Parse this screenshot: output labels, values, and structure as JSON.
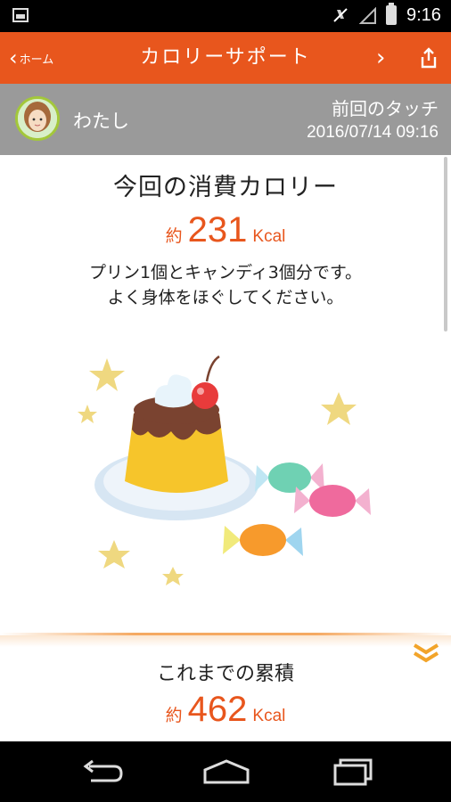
{
  "status_bar": {
    "time": "9:16",
    "icons": [
      "image-icon",
      "mute-icon",
      "signal-icon",
      "battery-icon"
    ]
  },
  "header": {
    "back_label": "ホーム",
    "title": "カロリーサポート",
    "next_icon": "chevron-right-icon",
    "share_icon": "share-icon"
  },
  "profile": {
    "name": "わたし",
    "last_touch_label": "前回のタッチ",
    "last_touch_time": "2016/07/14 09:16"
  },
  "current": {
    "title": "今回の消費カロリー",
    "approx": "約",
    "value": "231",
    "unit": "Kcal",
    "message_line1": "プリン1個とキャンディ3個分です。",
    "message_line2": "よく身体をほぐしてください。"
  },
  "total": {
    "title": "これまでの累積",
    "approx": "約",
    "value": "462",
    "unit": "Kcal"
  },
  "colors": {
    "accent": "#e8561d",
    "profile_bar": "#9a9a9a",
    "avatar_ring": "#a3c83a"
  },
  "nav_bar": {
    "icons": [
      "nav-back-icon",
      "nav-home-icon",
      "nav-recent-apps-icon"
    ]
  }
}
